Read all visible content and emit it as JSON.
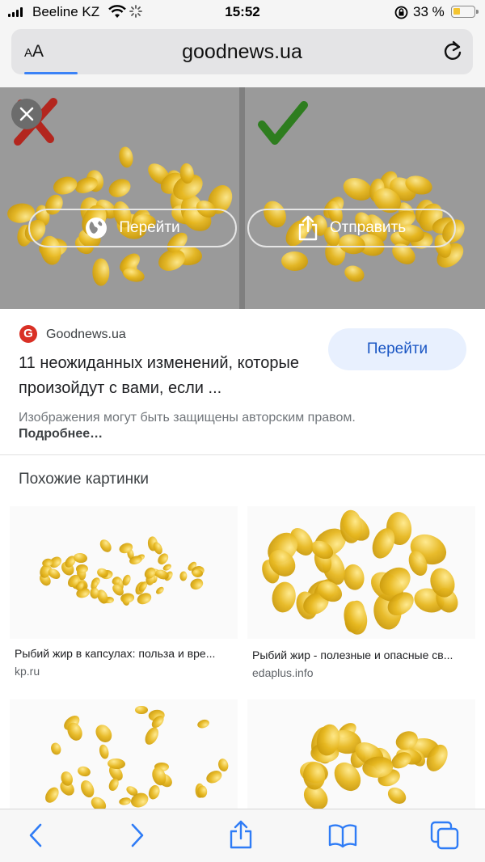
{
  "status_bar": {
    "carrier": "Beeline KZ",
    "time": "15:52",
    "battery_percent": "33 %",
    "battery_level": 0.33
  },
  "browser": {
    "text_size_button": "AA",
    "url": "goodnews.ua",
    "reload_icon": "reload-icon"
  },
  "preview": {
    "go_label": "Перейти",
    "send_label": "Отправить",
    "icons": [
      "close-icon",
      "globe-icon",
      "share-icon"
    ]
  },
  "result": {
    "source_logo": "G",
    "source_name": "Goodnews.ua",
    "title": "11 неожиданных изменений, которые произойдут с вами, если ...",
    "go_button": "Перейти",
    "copyright": "Изображения могут быть защищены авторским правом.",
    "more_link": "Подробнее…"
  },
  "similar": {
    "heading": "Похожие картинки",
    "items": [
      {
        "title": "Рыбий жир в капсулах: польза и вре...",
        "source": "kp.ru"
      },
      {
        "title": "Рыбий жир - полезные и опасные св...",
        "source": "edaplus.info"
      },
      {
        "title": "",
        "source": ""
      },
      {
        "title": "",
        "source": ""
      }
    ]
  },
  "toolbar": {
    "icons": [
      "back-icon",
      "forward-icon",
      "share-icon",
      "bookmarks-icon",
      "tabs-icon"
    ]
  },
  "colors": {
    "accent": "#1a56c4",
    "capsule": "#e7b820",
    "battery": "#f4c430",
    "source_logo": "#d93025"
  }
}
